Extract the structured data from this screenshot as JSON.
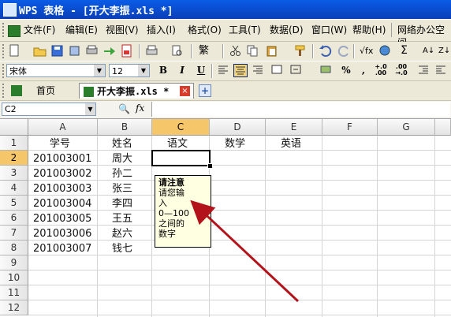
{
  "window": {
    "title": "WPS 表格 - [开大李振.xls *]"
  },
  "menu": {
    "items": [
      "文件(F)",
      "编辑(E)",
      "视图(V)",
      "插入(I)",
      "格式(O)",
      "工具(T)",
      "数据(D)",
      "窗口(W)",
      "帮助(H)",
      "网络办公空间"
    ]
  },
  "format": {
    "font_name": "宋体",
    "font_size": "12",
    "bold_label": "B",
    "italic_label": "I",
    "underline_label": "U",
    "percent_label": "%"
  },
  "tabs": {
    "home_label": "首页",
    "file_label": "开大李振.xls *",
    "add_label": "+"
  },
  "formula_bar": {
    "cell_ref": "C2",
    "fx_label": "fx",
    "value": ""
  },
  "sheet": {
    "columns": [
      "A",
      "B",
      "C",
      "D",
      "E",
      "F",
      "G"
    ],
    "rows": [
      "1",
      "2",
      "3",
      "4",
      "5",
      "6",
      "7",
      "8",
      "9",
      "10",
      "11",
      "12"
    ],
    "selected_cell": "C2",
    "cells": {
      "A1": "学号",
      "B1": "姓名",
      "C1": "语文",
      "D1": "数学",
      "E1": "英语",
      "A2": "201003001",
      "B2": "周大",
      "A3": "201003002",
      "B3": "孙二",
      "A4": "201003003",
      "B4": "张三",
      "A5": "201003004",
      "B5": "李四",
      "A6": "201003005",
      "B6": "王五",
      "A7": "201003006",
      "B7": "赵六",
      "A8": "201003007",
      "B8": "钱七"
    }
  },
  "input_message": {
    "title": "请注意",
    "line1": "请您输",
    "line2": "入",
    "line3": "0—100",
    "line4": "之间的",
    "line5": "数字"
  },
  "colors": {
    "title_bar": "#0a4fd8",
    "selection_header": "#f6c76a",
    "note_bg": "#ffffe1",
    "arrow": "#b3141c"
  }
}
